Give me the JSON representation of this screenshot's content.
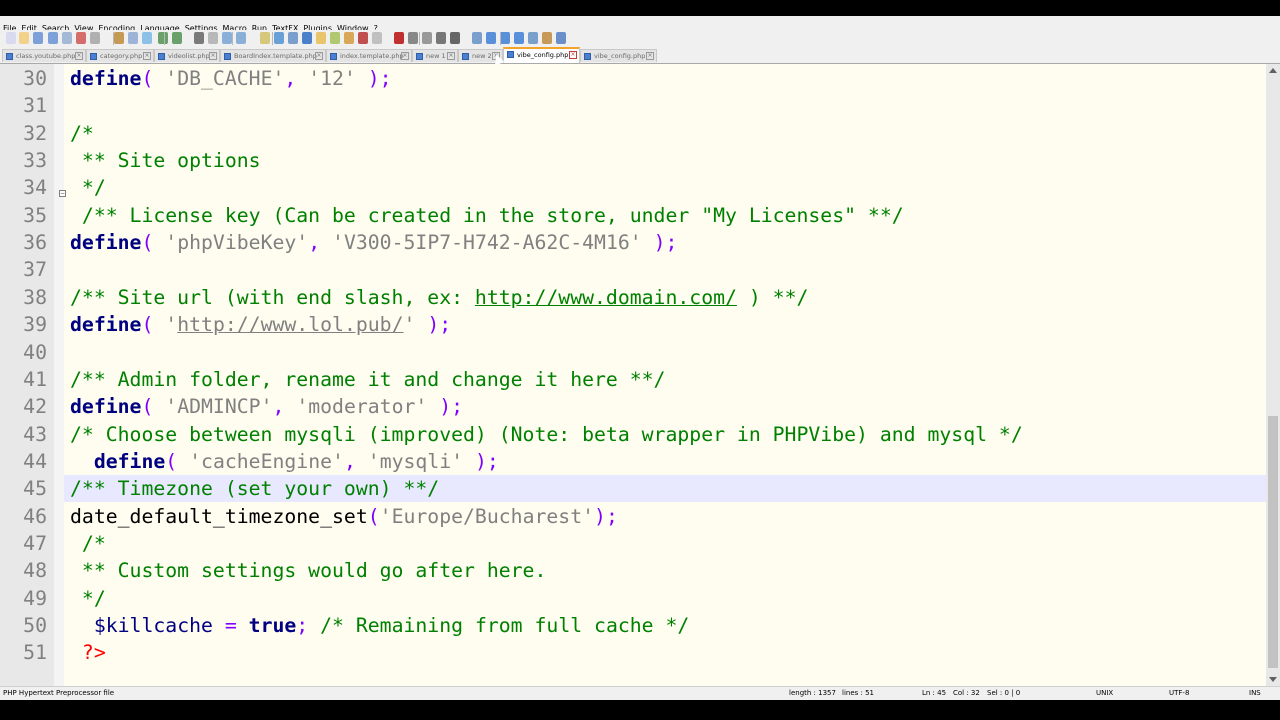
{
  "menu": [
    "File",
    "Edit",
    "Search",
    "View",
    "Encoding",
    "Language",
    "Settings",
    "Macro",
    "Run",
    "TextFX",
    "Plugins",
    "Window",
    "?"
  ],
  "tabs": [
    {
      "label": "class.youtube.php",
      "active": false
    },
    {
      "label": "category.php",
      "active": false
    },
    {
      "label": "videolist.php",
      "active": false
    },
    {
      "label": "BoardIndex.template.php",
      "active": false
    },
    {
      "label": "index.template.php",
      "active": false
    },
    {
      "label": "new 1",
      "active": false
    },
    {
      "label": "new 2",
      "active": false
    },
    {
      "label": "vibe_config.php",
      "active": true
    },
    {
      "label": "vibe_config.php",
      "active": false
    }
  ],
  "lines": [
    {
      "n": "30",
      "segs": [
        [
          "kw",
          "define"
        ],
        [
          "op",
          "( "
        ],
        [
          "str",
          "'DB_CACHE'"
        ],
        [
          "op",
          ", "
        ],
        [
          "str",
          "'12'"
        ],
        [
          "op",
          " );"
        ]
      ]
    },
    {
      "n": "31",
      "segs": []
    },
    {
      "n": "32",
      "segs": [
        [
          "cmt",
          "/*"
        ]
      ]
    },
    {
      "n": "33",
      "segs": [
        [
          "cmt",
          " ** Site options"
        ]
      ]
    },
    {
      "n": "34",
      "segs": [
        [
          "cmt",
          " */"
        ]
      ]
    },
    {
      "n": "35",
      "segs": [
        [
          "cmt",
          " /** License key (Can be created in the store, under \"My Licenses\" **/"
        ]
      ]
    },
    {
      "n": "36",
      "segs": [
        [
          "kw",
          "define"
        ],
        [
          "op",
          "( "
        ],
        [
          "str",
          "'phpVibeKey'"
        ],
        [
          "op",
          ", "
        ],
        [
          "str",
          "'V300-5IP7-H742-A62C-4M16'"
        ],
        [
          "op",
          " );"
        ]
      ]
    },
    {
      "n": "37",
      "segs": []
    },
    {
      "n": "38",
      "segs": [
        [
          "cmt",
          "/** Site url (with end slash, ex: "
        ],
        [
          "cmt url",
          "http://www.domain.com/"
        ],
        [
          "cmt",
          " ) **/"
        ]
      ]
    },
    {
      "n": "39",
      "segs": [
        [
          "kw",
          "define"
        ],
        [
          "op",
          "( "
        ],
        [
          "str",
          "'"
        ],
        [
          "str url",
          "http://www.lol.pub/"
        ],
        [
          "str",
          "'"
        ],
        [
          "op",
          " );"
        ]
      ]
    },
    {
      "n": "40",
      "segs": []
    },
    {
      "n": "41",
      "segs": [
        [
          "cmt",
          "/** Admin folder, rename it and change it here **/"
        ]
      ]
    },
    {
      "n": "42",
      "segs": [
        [
          "kw",
          "define"
        ],
        [
          "op",
          "( "
        ],
        [
          "str",
          "'ADMINCP'"
        ],
        [
          "op",
          ", "
        ],
        [
          "str",
          "'moderator'"
        ],
        [
          "op",
          " );"
        ]
      ]
    },
    {
      "n": "43",
      "segs": [
        [
          "cmt",
          "/* Choose between mysqli (improved) (Note: beta wrapper in PHPVibe) and mysql */"
        ]
      ]
    },
    {
      "n": "44",
      "segs": [
        [
          "",
          "  "
        ],
        [
          "kw",
          "define"
        ],
        [
          "op",
          "( "
        ],
        [
          "str",
          "'cacheEngine'"
        ],
        [
          "op",
          ", "
        ],
        [
          "str",
          "'mysqli'"
        ],
        [
          "op",
          " );"
        ]
      ]
    },
    {
      "n": "45",
      "segs": [
        [
          "cmt",
          "/** Timezone (set your own) **/"
        ]
      ]
    },
    {
      "n": "46",
      "segs": [
        [
          "",
          "date_default_timezone_set"
        ],
        [
          "op",
          "("
        ],
        [
          "str",
          "'Europe/Bucharest'"
        ],
        [
          "op",
          ");"
        ]
      ]
    },
    {
      "n": "47",
      "segs": [
        [
          "cmt",
          " /*"
        ]
      ]
    },
    {
      "n": "48",
      "segs": [
        [
          "cmt",
          " ** Custom settings would go after here."
        ]
      ]
    },
    {
      "n": "49",
      "segs": [
        [
          "cmt",
          " */"
        ]
      ]
    },
    {
      "n": "50",
      "segs": [
        [
          "",
          "  "
        ],
        [
          "var",
          "$killcache"
        ],
        [
          "op",
          " = "
        ],
        [
          "kw",
          "true"
        ],
        [
          "op",
          ";"
        ],
        [
          "cmt",
          " /* Remaining from full cache */"
        ]
      ]
    },
    {
      "n": "51",
      "segs": [
        [
          "tag",
          " ?>"
        ]
      ]
    }
  ],
  "status": {
    "filetype": "PHP Hypertext Preprocessor file",
    "length": "length : 1357",
    "lines": "lines : 51",
    "pos": "Ln : 45",
    "col": "Col : 32",
    "sel": "Sel : 0 | 0",
    "eol": "UNIX",
    "encoding": "UTF-8",
    "mode": "INS"
  }
}
